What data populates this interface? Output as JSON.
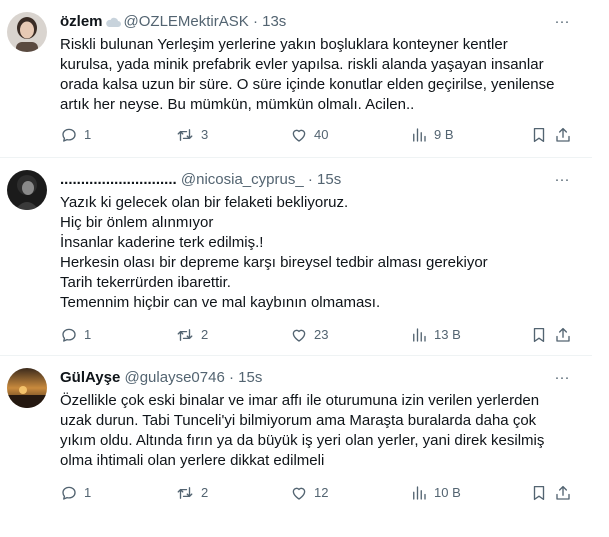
{
  "tweets": [
    {
      "name": "özlem",
      "has_cloud_emoji": true,
      "handle": "@OZLEMektirASK",
      "separator": "·",
      "time": "13s",
      "lines": [
        "Riskli bulunan Yerleşim yerlerine yakın boşluklara konteyner kentler",
        "kurulsa, yada minik prefabrik evler yapılsa. riskli alanda yaşayan insanlar",
        "orada kalsa uzun bir süre. O süre içinde konutlar elden geçirilse, yenilense",
        "artık her neyse. Bu mümkün, mümkün olmalı. Acilen.."
      ],
      "replies": "1",
      "retweets": "3",
      "likes": "40",
      "views": "9 B"
    },
    {
      "name": "............................",
      "has_cloud_emoji": false,
      "handle": "@nicosia_cyprus_",
      "separator": "·",
      "time": "15s",
      "lines": [
        "Yazık ki gelecek olan bir felaketi bekliyoruz.",
        "Hiç bir önlem alınmıyor",
        "İnsanlar kaderine terk edilmiş.!",
        "Herkesin olası bir depreme karşı bireysel tedbir alması gerekiyor",
        "Tarih tekerrürden ibarettir.",
        "Temennim hiçbir can ve mal kaybının olmaması."
      ],
      "replies": "1",
      "retweets": "2",
      "likes": "23",
      "views": "13 B"
    },
    {
      "name": "GülAyşe",
      "has_cloud_emoji": false,
      "handle": "@gulayse0746",
      "separator": "·",
      "time": "15s",
      "lines": [
        "Özellikle çok eski binalar ve imar affı ile oturumuna izin verilen yerlerden",
        "uzak durun. Tabi Tunceli'yi bilmiyorum ama Maraşta buralarda daha çok",
        "yıkım oldu. Altında fırın ya da büyük iş yeri olan yerler, yani direk kesilmiş",
        "olma ihtimali olan yerlere dikkat edilmeli"
      ],
      "replies": "1",
      "retweets": "2",
      "likes": "12",
      "views": "10 B"
    }
  ],
  "more_glyph": "···",
  "colors": {
    "text": "#0f1419",
    "secondary": "#536471",
    "divider": "#eff3f4"
  }
}
